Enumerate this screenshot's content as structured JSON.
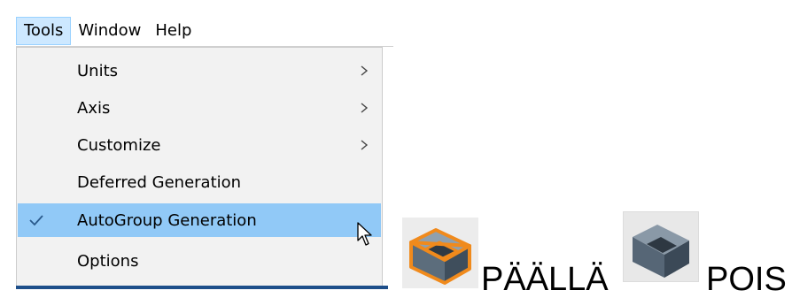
{
  "menubar": {
    "items": [
      {
        "label": "Tools"
      },
      {
        "label": "Window"
      },
      {
        "label": "Help"
      }
    ]
  },
  "tools_menu": {
    "items": [
      {
        "label": "Units",
        "submenu": true
      },
      {
        "label": "Axis",
        "submenu": true
      },
      {
        "label": "Customize",
        "submenu": true
      },
      {
        "label": "Deferred Generation",
        "submenu": false
      },
      {
        "label": "AutoGroup Generation",
        "checked": true,
        "highlighted": true
      },
      {
        "label": "Options",
        "submenu": false
      }
    ]
  },
  "legend": {
    "on_label": "PÄÄLLÄ",
    "off_label": "POIS",
    "on_icon": "autogroup-on-icon",
    "off_icon": "autogroup-off-icon"
  },
  "colors": {
    "highlight": "#91c9f7",
    "active_menu": "#cde8ff",
    "accent_orange": "#f08a1c",
    "check": "#2a5a8c"
  }
}
